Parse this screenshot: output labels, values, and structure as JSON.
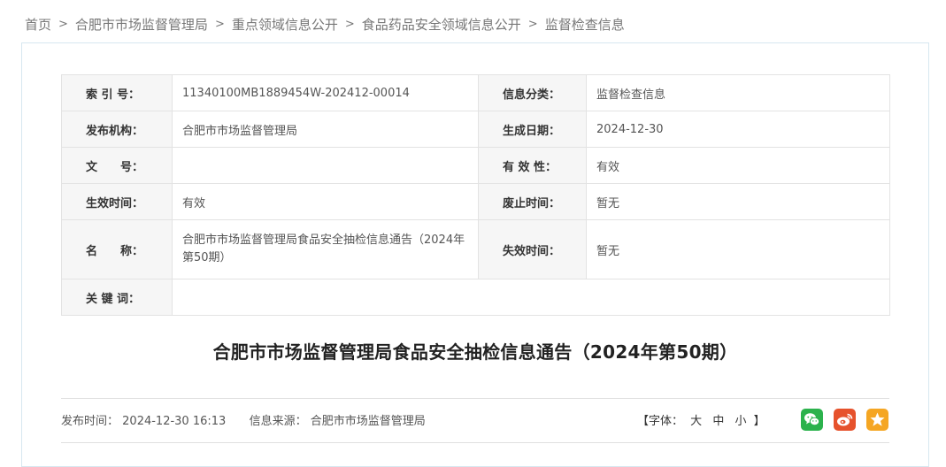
{
  "breadcrumb": [
    {
      "label": "首页"
    },
    {
      "label": "合肥市市场监督管理局"
    },
    {
      "label": "重点领域信息公开"
    },
    {
      "label": "食品药品安全领域信息公开"
    },
    {
      "label": "监督检查信息"
    }
  ],
  "breadcrumb_sep": ">",
  "meta": {
    "index_label": "索 引 号：",
    "index_value": "11340100MB1889454W-202412-00014",
    "category_label": "信息分类：",
    "category_value": "监督检查信息",
    "publisher_label": "发布机构：",
    "publisher_value": "合肥市市场监督管理局",
    "created_label": "生成日期：",
    "created_value": "2024-12-30",
    "docno_label": "文　　号：",
    "docno_value": "",
    "validity_label": "有 效 性：",
    "validity_value": "有效",
    "effective_label": "生效时间：",
    "effective_value": "有效",
    "repeal_label": "废止时间：",
    "repeal_value": "暂无",
    "name_label": "名　　称：",
    "name_value": "合肥市市场监督管理局食品安全抽检信息通告（2024年第50期）",
    "expire_label": "失效时间：",
    "expire_value": "暂无",
    "keywords_label": "关 键 词：",
    "keywords_value": ""
  },
  "title": "合肥市市场监督管理局食品安全抽检信息通告（2024年第50期）",
  "info": {
    "publish_label": "发布时间：",
    "publish_value": "2024-12-30 16:13",
    "source_label": "信息来源：",
    "source_value": "合肥市市场监督管理局"
  },
  "font_size": {
    "prefix": "【字体：",
    "large": "大",
    "medium": "中",
    "small": "小",
    "suffix": "】"
  },
  "share_icons": {
    "wechat": {
      "icon": "wechat-icon",
      "color": "#2bb24c"
    },
    "weibo": {
      "icon": "weibo-icon",
      "color": "#e6522c"
    },
    "favorite": {
      "icon": "star-icon",
      "color": "#f5a623"
    }
  }
}
